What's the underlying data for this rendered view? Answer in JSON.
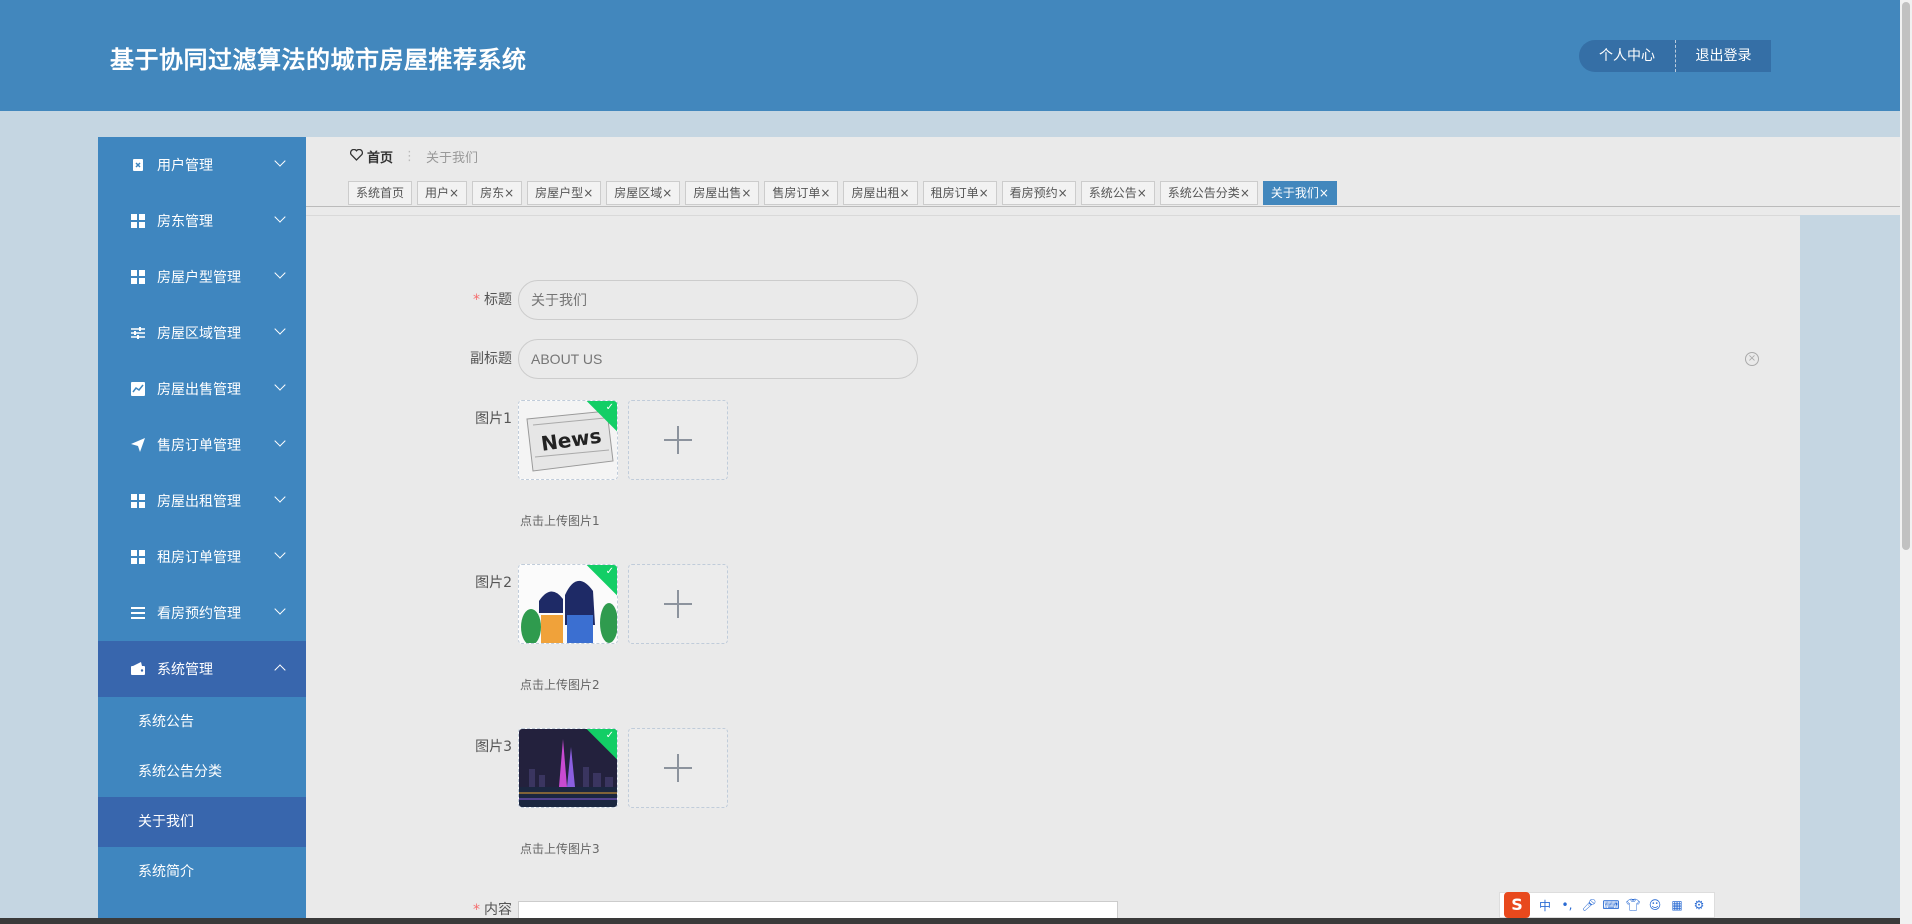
{
  "header": {
    "title": "基于协同过滤算法的城市房屋推荐系统",
    "personal_center": "个人中心",
    "logout": "退出登录"
  },
  "sidebar": {
    "items": [
      {
        "label": "用户管理",
        "icon": "clipboard-icon"
      },
      {
        "label": "房东管理",
        "icon": "grid-icon"
      },
      {
        "label": "房屋户型管理",
        "icon": "grid-icon"
      },
      {
        "label": "房屋区域管理",
        "icon": "sliders-icon"
      },
      {
        "label": "房屋出售管理",
        "icon": "chart-icon"
      },
      {
        "label": "售房订单管理",
        "icon": "send-icon"
      },
      {
        "label": "房屋出租管理",
        "icon": "grid-icon"
      },
      {
        "label": "租房订单管理",
        "icon": "grid-icon"
      },
      {
        "label": "看房预约管理",
        "icon": "list-icon"
      },
      {
        "label": "系统管理",
        "icon": "wallet-icon"
      }
    ],
    "sub_items": [
      "系统公告",
      "系统公告分类",
      "关于我们",
      "系统简介"
    ]
  },
  "breadcrumb": {
    "home": "首页",
    "separator": "⋮",
    "current": "关于我们"
  },
  "tabs": [
    "系统首页",
    "用户",
    "房东",
    "房屋户型",
    "房屋区域",
    "房屋出售",
    "售房订单",
    "房屋出租",
    "租房订单",
    "看房预约",
    "系统公告",
    "系统公告分类",
    "关于我们"
  ],
  "tab_close": "×",
  "form": {
    "title_label": "标题",
    "title_value": "关于我们",
    "subtitle_label": "副标题",
    "subtitle_value": "ABOUT US",
    "required_mark": "*",
    "image1_label": "图片1",
    "image1_tip": "点击上传图片1",
    "image2_label": "图片2",
    "image2_tip": "点击上传图片2",
    "image3_label": "图片3",
    "image3_tip": "点击上传图片3",
    "content_label": "内容",
    "image1_text": "News"
  },
  "ime": {
    "logo": "S",
    "mode": "中"
  },
  "colors": {
    "header": "#4287bd",
    "sidebar": "#3f86bf",
    "sidebar_active": "#3866ad",
    "upload_success": "#13ce66"
  }
}
